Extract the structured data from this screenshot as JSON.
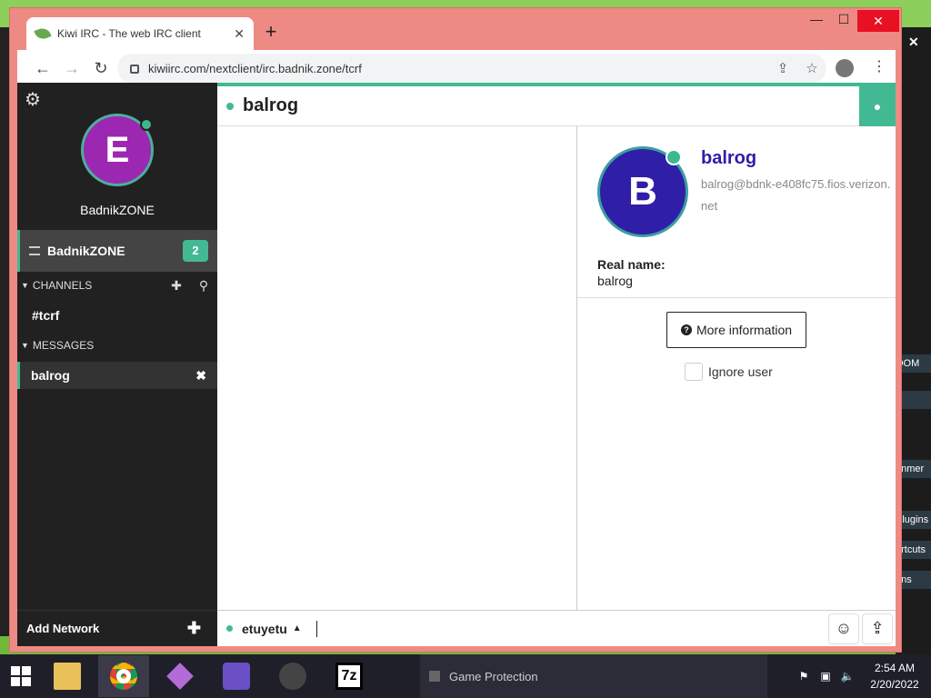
{
  "browser": {
    "tab_title": "Kiwi IRC - The web IRC client",
    "url": "kiwiirc.com/nextclient/irc.badnik.zone/tcrf"
  },
  "sidebar": {
    "self_avatar_letter": "E",
    "network_name": "BadnikZONE",
    "network_item_label": "BadnikZONE",
    "network_unread": "2",
    "channels_header": "CHANNELS",
    "channels": [
      "#tcrf"
    ],
    "messages_header": "MESSAGES",
    "messages": [
      "balrog"
    ],
    "add_network": "Add Network"
  },
  "header": {
    "buffer_name": "balrog"
  },
  "userpanel": {
    "avatar_letter": "B",
    "nick": "balrog",
    "host": "balrog@bdnk-e408fc75.fios.verizon.net",
    "realname_label": "Real name:",
    "realname": "balrog",
    "more_info": "More information",
    "ignore_label": "Ignore user"
  },
  "input": {
    "my_nick": "etuyetu",
    "value": ""
  },
  "background_window": {
    "fragments": [
      "OOM",
      "F",
      "gnmer",
      "Plugins",
      "ortcuts",
      "ons"
    ]
  },
  "taskbar": {
    "task_label": "Game Protection",
    "time": "2:54 AM",
    "date": "2/20/2022"
  },
  "colors": {
    "accent": "#42b992",
    "sidebar_bg": "#212121",
    "self_avatar": "#9c27b0",
    "user_avatar": "#2e1ea8",
    "browser_frame": "#ee8a84"
  }
}
